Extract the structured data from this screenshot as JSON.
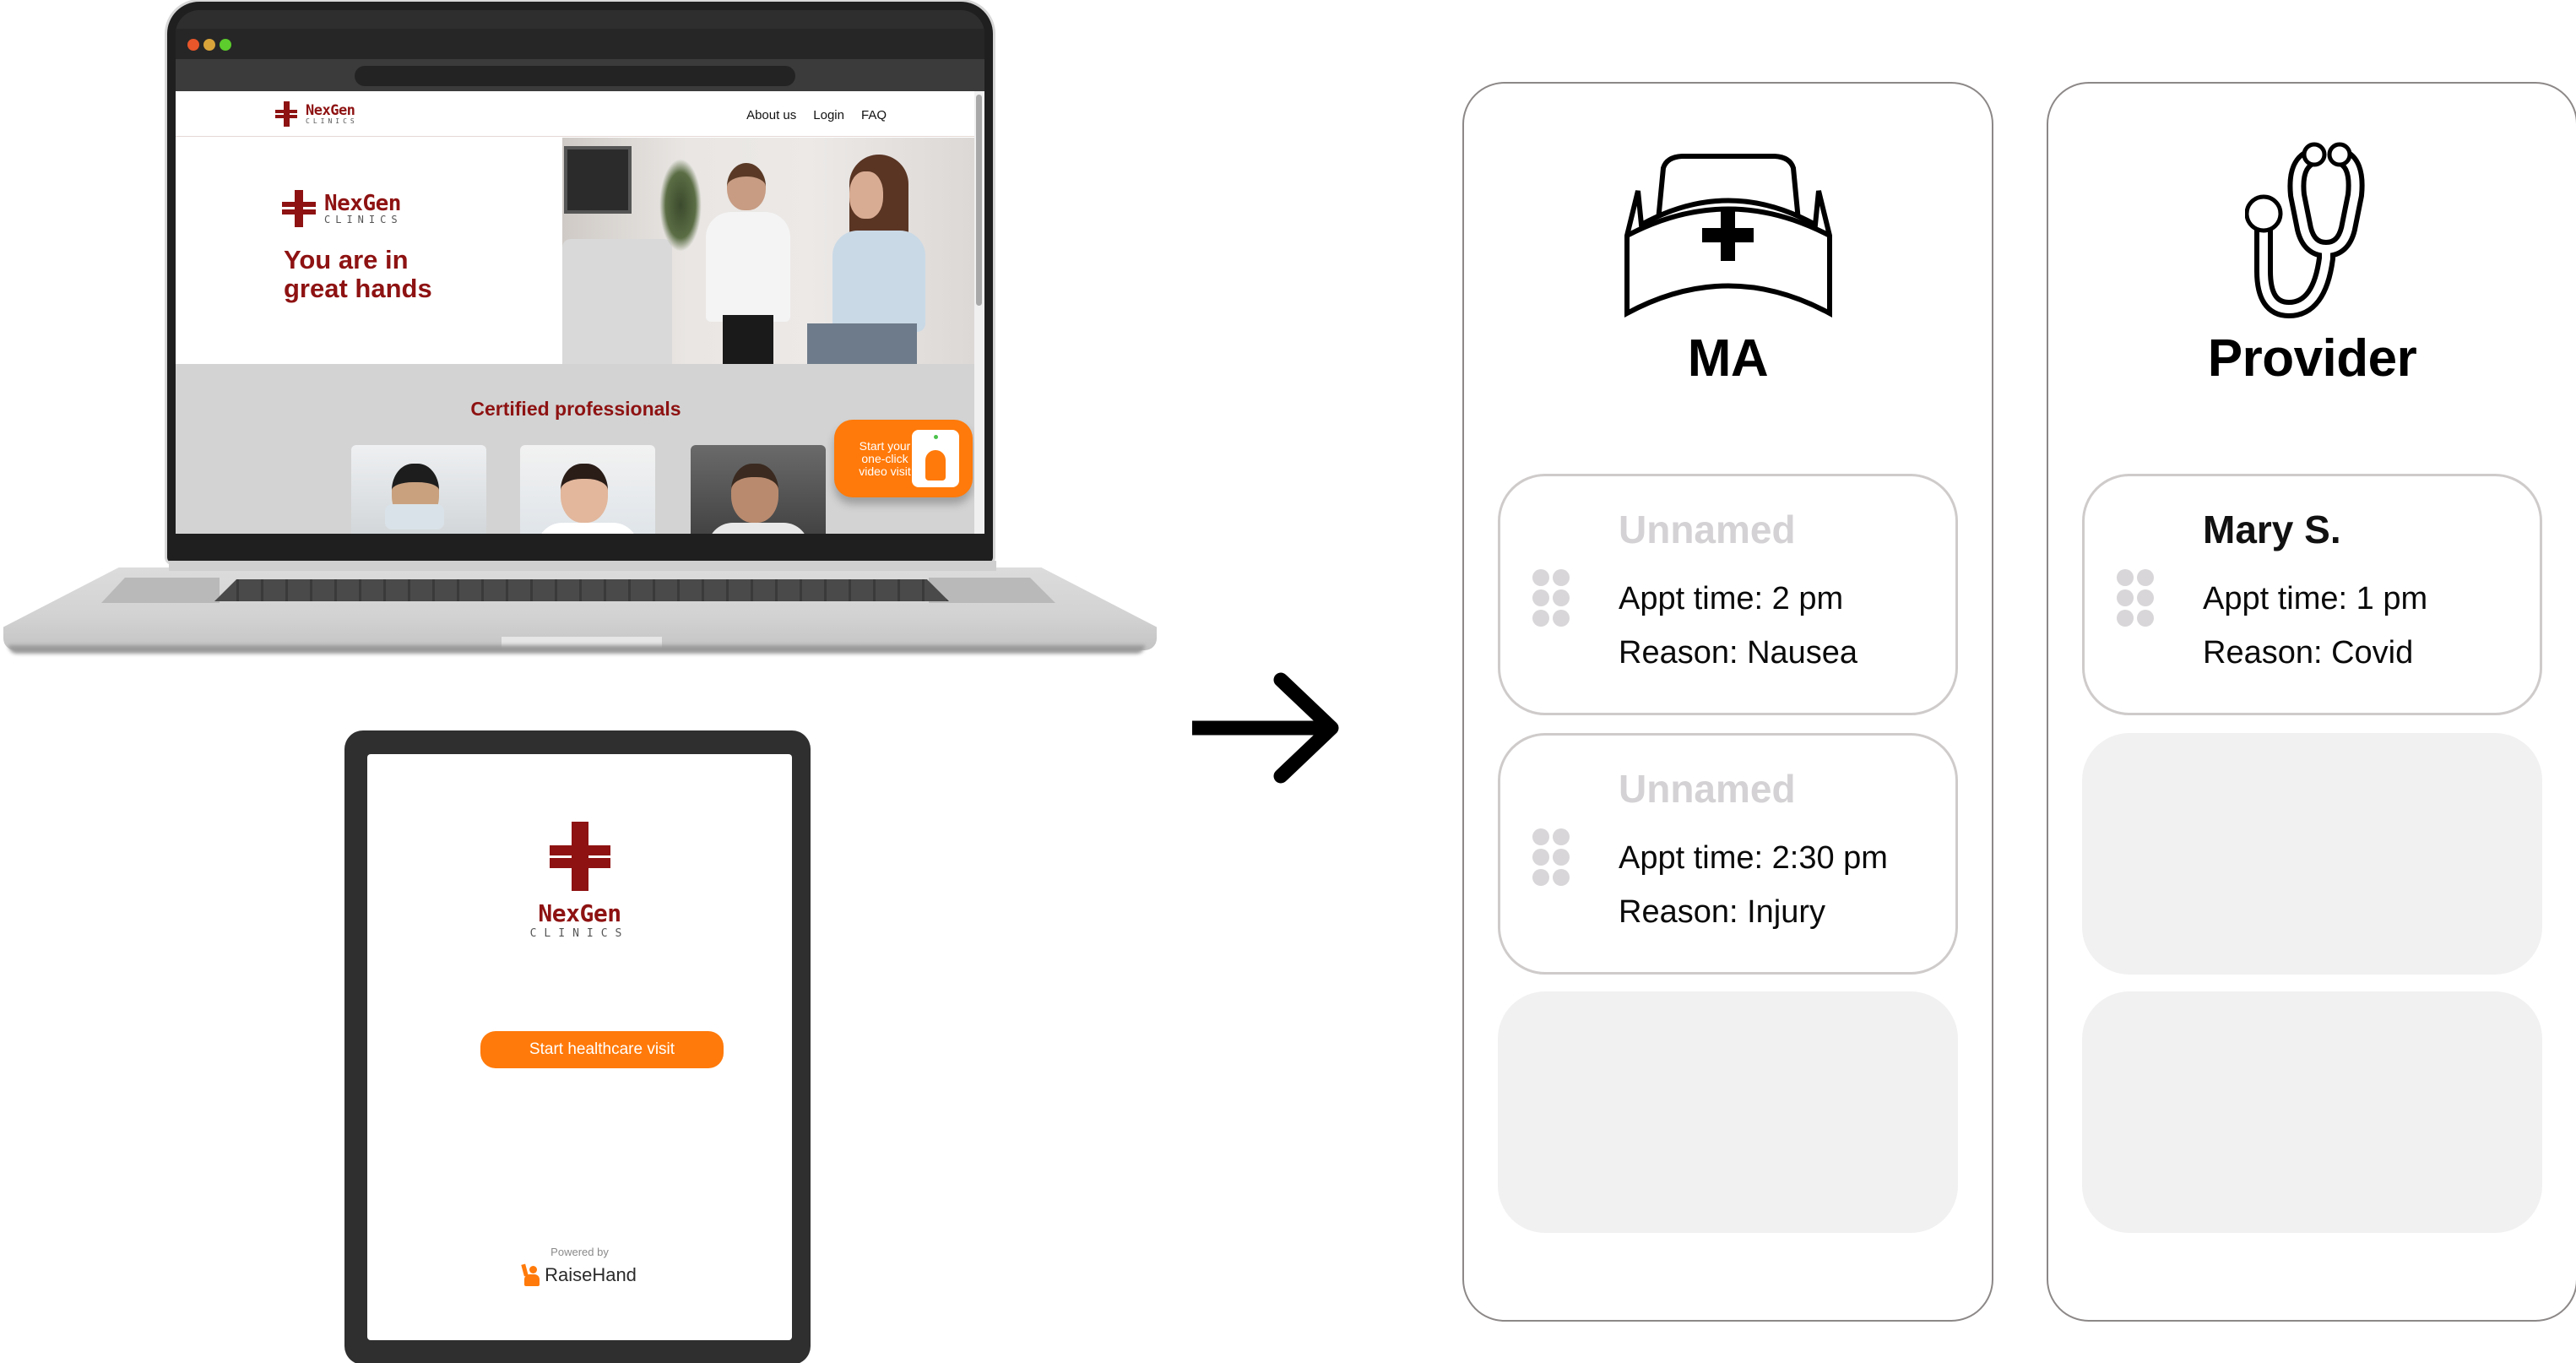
{
  "laptop": {
    "site": {
      "logo": {
        "name": "NexGen",
        "sub": "CLINICS"
      },
      "nav": [
        "About us",
        "Login",
        "FAQ"
      ],
      "hero_logo": {
        "name": "NexGen",
        "sub": "CLINICS"
      },
      "tagline_line1": "You are in",
      "tagline_line2": "great hands",
      "section_title": "Certified professionals",
      "video_cta": "Start your one-click video visit"
    }
  },
  "tablet": {
    "logo": {
      "name": "NexGen",
      "sub": "CLINICS"
    },
    "cta_label": "Start healthcare visit",
    "powered_by": "Powered by",
    "brand": "RaiseHand"
  },
  "colors": {
    "brand_red": "#8e1212",
    "accent_orange": "#ff7a0a",
    "panel_border": "#8d8888",
    "placeholder_gray": "#f1f1f1"
  },
  "panels": {
    "ma": {
      "title": "MA",
      "icon": "nurse-cap-icon",
      "cards": [
        {
          "name": "Unnamed",
          "appt": "Appt time: 2 pm",
          "reason": "Reason: Nausea"
        },
        {
          "name": "Unnamed",
          "appt": "Appt time: 2:30 pm",
          "reason": "Reason: Injury"
        }
      ],
      "empty_slots": 1
    },
    "provider": {
      "title": "Provider",
      "icon": "stethoscope-icon",
      "cards": [
        {
          "name": "Mary S.",
          "appt": "Appt time: 1 pm",
          "reason": "Reason: Covid"
        }
      ],
      "empty_slots": 2
    }
  }
}
